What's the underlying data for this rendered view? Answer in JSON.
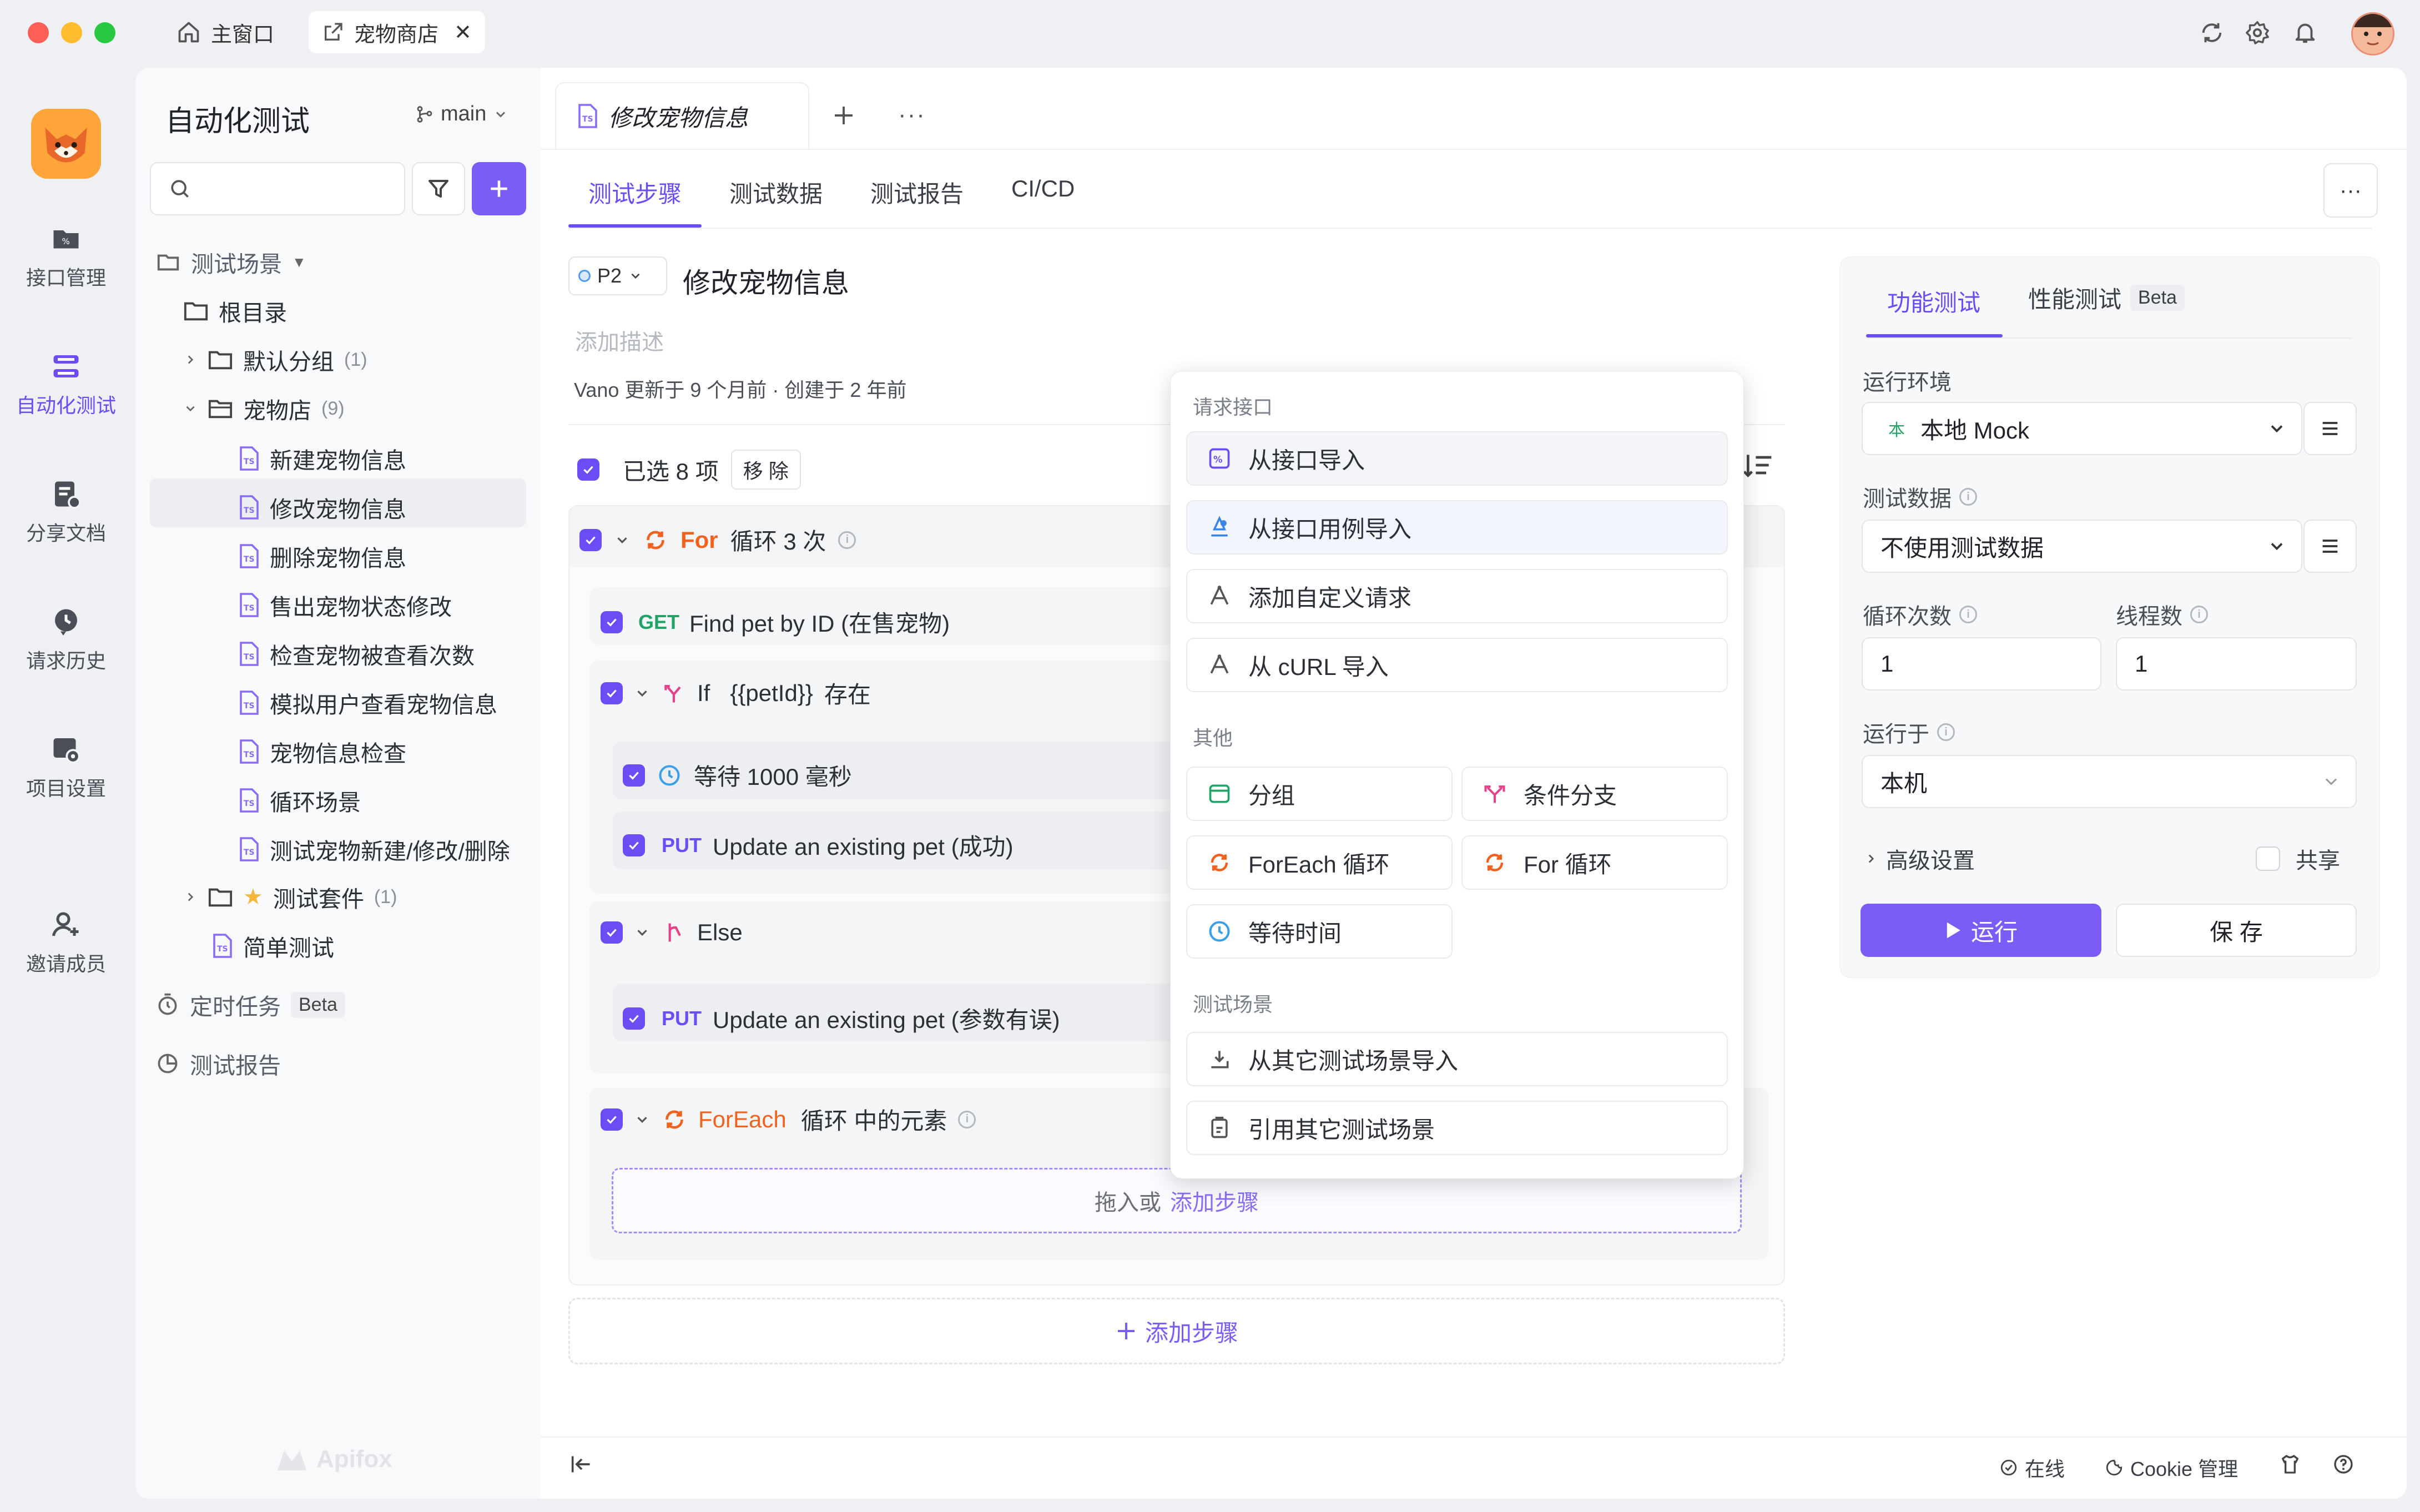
{
  "titlebar": {
    "home_tab": "主窗口",
    "project_tab": "宠物商店"
  },
  "rail": [
    {
      "label": "接口管理"
    },
    {
      "label": "自动化测试"
    },
    {
      "label": "分享文档"
    },
    {
      "label": "请求历史"
    },
    {
      "label": "项目设置"
    },
    {
      "label": "邀请成员"
    }
  ],
  "sidebar": {
    "title": "自动化测试",
    "branch": "main",
    "section_scenes": "测试场景",
    "root": "根目录",
    "default_group": {
      "label": "默认分组",
      "count": "(1)"
    },
    "pet_store": {
      "label": "宠物店",
      "count": "(9)"
    },
    "scenes": [
      "新建宠物信息",
      "修改宠物信息",
      "删除宠物信息",
      "售出宠物状态修改",
      "检查宠物被查看次数",
      "模拟用户查看宠物信息",
      "宠物信息检查",
      "循环场景",
      "测试宠物新建/修改/删除"
    ],
    "suite": {
      "label": "测试套件",
      "count": "(1)"
    },
    "simple": "简单测试",
    "scheduled": "定时任务",
    "scheduled_badge": "Beta",
    "reports": "测试报告",
    "watermark": "Apifox"
  },
  "doc_tab": "修改宠物信息",
  "subtabs": [
    "测试步骤",
    "测试数据",
    "测试报告",
    "CI/CD"
  ],
  "scenario": {
    "priority": "P2",
    "name": "修改宠物信息",
    "desc_placeholder": "添加描述",
    "meta": "Vano 更新于 9 个月前 · 创建于 2 年前",
    "selected": "已选 8 项",
    "remove": "移 除"
  },
  "steps": {
    "for_kw": "For",
    "for_text": "循环 3 次",
    "get_method": "GET",
    "get_text": "Find pet by ID (在售宠物)",
    "if_kw": "If",
    "if_var": "{{petId}}",
    "if_op": "存在",
    "wait_text": "等待 1000 毫秒",
    "put_method": "PUT",
    "put1_text": "Update an existing pet (成功)",
    "else_kw": "Else",
    "put2_text": "Update an existing pet (参数有误)",
    "foreach_kw": "ForEach",
    "foreach_text": "循环 中的元素",
    "drop_text": "拖入或",
    "drop_link": "添加步骤",
    "add_step": "添加步骤"
  },
  "menu": {
    "sec_request": "请求接口",
    "import_api": "从接口导入",
    "import_case": "从接口用例导入",
    "custom_request": "添加自定义请求",
    "import_curl": "从 cURL 导入",
    "sec_other": "其他",
    "group": "分组",
    "branch": "条件分支",
    "foreach": "ForEach 循环",
    "for_loop": "For 循环",
    "wait": "等待时间",
    "sec_scene": "测试场景",
    "import_scene": "从其它测试场景导入",
    "ref_scene": "引用其它测试场景"
  },
  "panel": {
    "tab_func": "功能测试",
    "tab_perf": "性能测试",
    "tab_perf_badge": "Beta",
    "env_label": "运行环境",
    "env_badge": "本",
    "env_value": "本地 Mock",
    "data_label": "测试数据",
    "data_value": "不使用测试数据",
    "loop_label": "循环次数",
    "loop_value": "1",
    "thread_label": "线程数",
    "thread_value": "1",
    "runon_label": "运行于",
    "runon_value": "本机",
    "advanced": "高级设置",
    "share": "共享",
    "run": "运行",
    "save": "保 存"
  },
  "statusbar": {
    "online": "在线",
    "cookie": "Cookie 管理"
  }
}
